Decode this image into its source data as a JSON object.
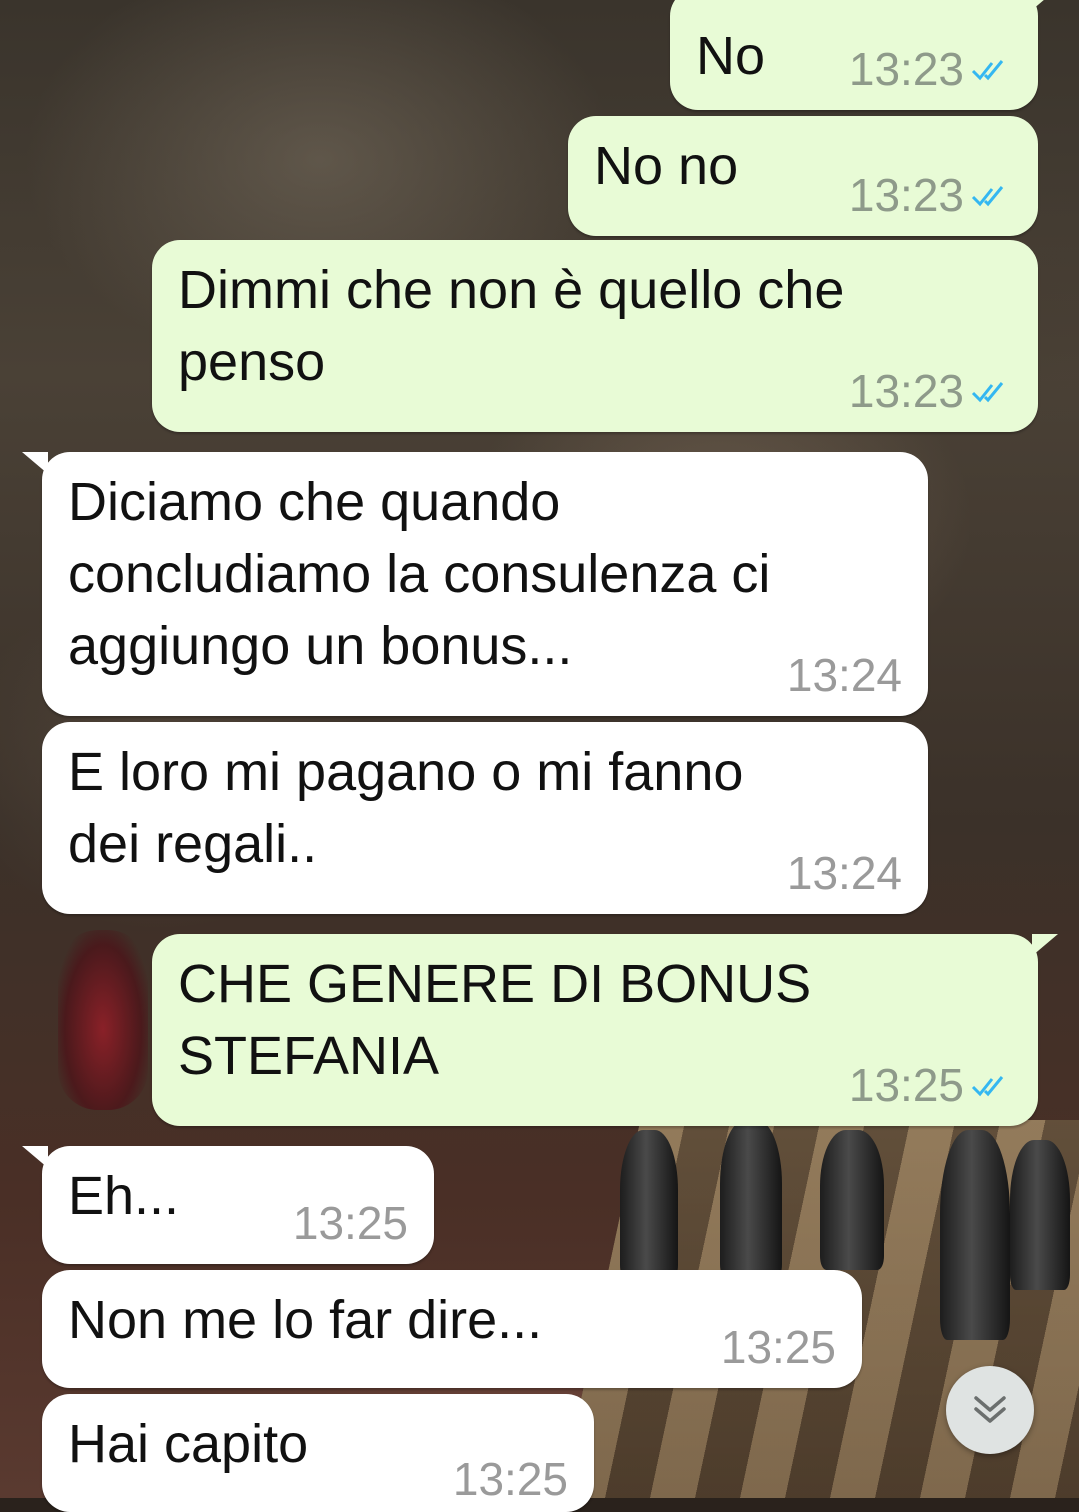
{
  "messages": [
    {
      "direction": "out",
      "text": "No",
      "time": "13:23",
      "status": "read"
    },
    {
      "direction": "out",
      "text": "No no",
      "time": "13:23",
      "status": "read"
    },
    {
      "direction": "out",
      "text": "Dimmi che non è quello che\npenso",
      "time": "13:23",
      "status": "read"
    },
    {
      "direction": "in",
      "text": "Diciamo che quando\nconcludiamo la consulenza ci\naggiungo un bonus...",
      "time": "13:24"
    },
    {
      "direction": "in",
      "text": "E loro mi pagano o mi fanno\ndei regali..",
      "time": "13:24"
    },
    {
      "direction": "out",
      "text": "CHE GENERE DI BONUS\nSTEFANIA",
      "time": "13:25",
      "status": "read"
    },
    {
      "direction": "in",
      "text": "Eh...",
      "time": "13:25"
    },
    {
      "direction": "in",
      "text": "Non me lo far dire...",
      "time": "13:25"
    },
    {
      "direction": "in",
      "text": "Hai capito",
      "time": "13:25"
    }
  ],
  "colors": {
    "outgoing_bubble": "#e8fbd6",
    "incoming_bubble": "#ffffff",
    "read_ticks": "#34b7f1",
    "timestamp": "#8e9a8a"
  },
  "icons": {
    "read_status": "double-check-icon",
    "scroll_down": "chevron-double-down-icon"
  }
}
